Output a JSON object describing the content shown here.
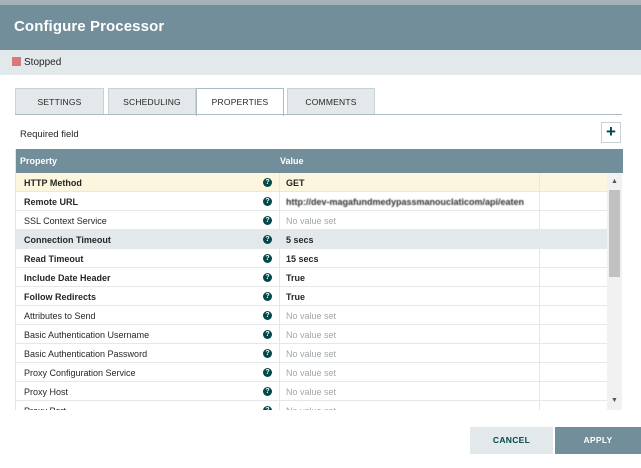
{
  "dialog": {
    "title": "Configure Processor"
  },
  "status": {
    "text": "Stopped",
    "color": "#d8777c"
  },
  "tabs": [
    {
      "label": "SETTINGS"
    },
    {
      "label": "SCHEDULING"
    },
    {
      "label": "PROPERTIES",
      "active": true
    },
    {
      "label": "COMMENTS"
    }
  ],
  "required_label": "Required field",
  "add_button": "+",
  "grid": {
    "headers": {
      "property": "Property",
      "value": "Value"
    },
    "rows": [
      {
        "name": "HTTP Method",
        "required": true,
        "value": "GET",
        "style": "highlight"
      },
      {
        "name": "Remote URL",
        "required": true,
        "value": "http://dev-magafundmedypassmanouclaticom/api/eaten",
        "obscured": true
      },
      {
        "name": "SSL Context Service",
        "required": false,
        "value": "No value set",
        "unset": true
      },
      {
        "name": "Connection Timeout",
        "required": true,
        "value": "5 secs",
        "style": "selected"
      },
      {
        "name": "Read Timeout",
        "required": true,
        "value": "15 secs"
      },
      {
        "name": "Include Date Header",
        "required": true,
        "value": "True"
      },
      {
        "name": "Follow Redirects",
        "required": true,
        "value": "True"
      },
      {
        "name": "Attributes to Send",
        "required": false,
        "value": "No value set",
        "unset": true
      },
      {
        "name": "Basic Authentication Username",
        "required": false,
        "value": "No value set",
        "unset": true
      },
      {
        "name": "Basic Authentication Password",
        "required": false,
        "value": "No value set",
        "unset": true
      },
      {
        "name": "Proxy Configuration Service",
        "required": false,
        "value": "No value set",
        "unset": true
      },
      {
        "name": "Proxy Host",
        "required": false,
        "value": "No value set",
        "unset": true
      },
      {
        "name": "Proxy Port",
        "required": false,
        "value": "No value set",
        "unset": true
      }
    ]
  },
  "footer": {
    "cancel": "CANCEL",
    "apply": "APPLY"
  },
  "colors": {
    "header": "#728e9b",
    "accent": "#004849",
    "tab_bg": "#e3e8eb",
    "highlight_row": "#fcf6de"
  }
}
